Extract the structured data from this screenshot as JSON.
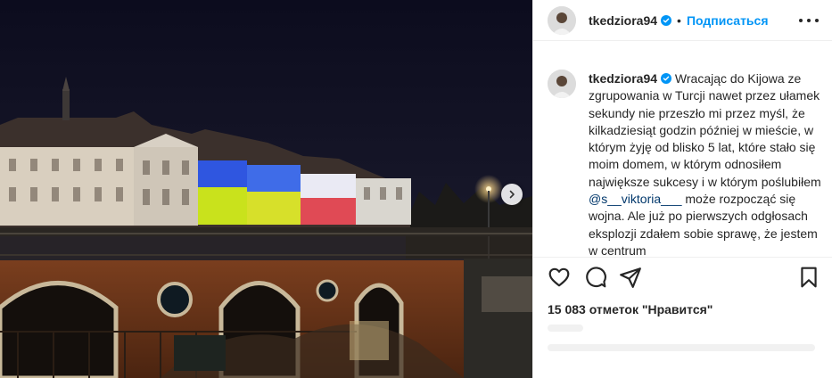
{
  "post": {
    "username": "tkedziora94",
    "follow_label": "Подписаться",
    "separator": "•",
    "caption_before": " Wracając do Kijowa ze zgrupowania w Turcji nawet przez ułamek sekundy nie przeszło mi przez myśl, że kilkadziesiąt godzin później w mieście, w którym żyję od blisko 5 lat, które stało się moim domem, w którym odnosiłem największe sukcesy i w którym poślubiłem ",
    "mention": "@s__viktoria___",
    "caption_after": " może rozpocząć się wojna. Ale już po pierwszych odgłosach eksplozji zdałem sobie sprawę, że jestem w centrum",
    "likes_text": "15 083 отметок \"Нравится\""
  },
  "colors": {
    "accent": "#0095f6",
    "mention": "#00376b",
    "text": "#262626",
    "ukraine_blue": "#1d3fd0",
    "ukraine_yellow": "#d8e21c"
  },
  "icons": [
    "verified-icon",
    "more-options-icon",
    "heart-icon",
    "comment-icon",
    "share-icon",
    "bookmark-icon",
    "chevron-right-icon"
  ]
}
